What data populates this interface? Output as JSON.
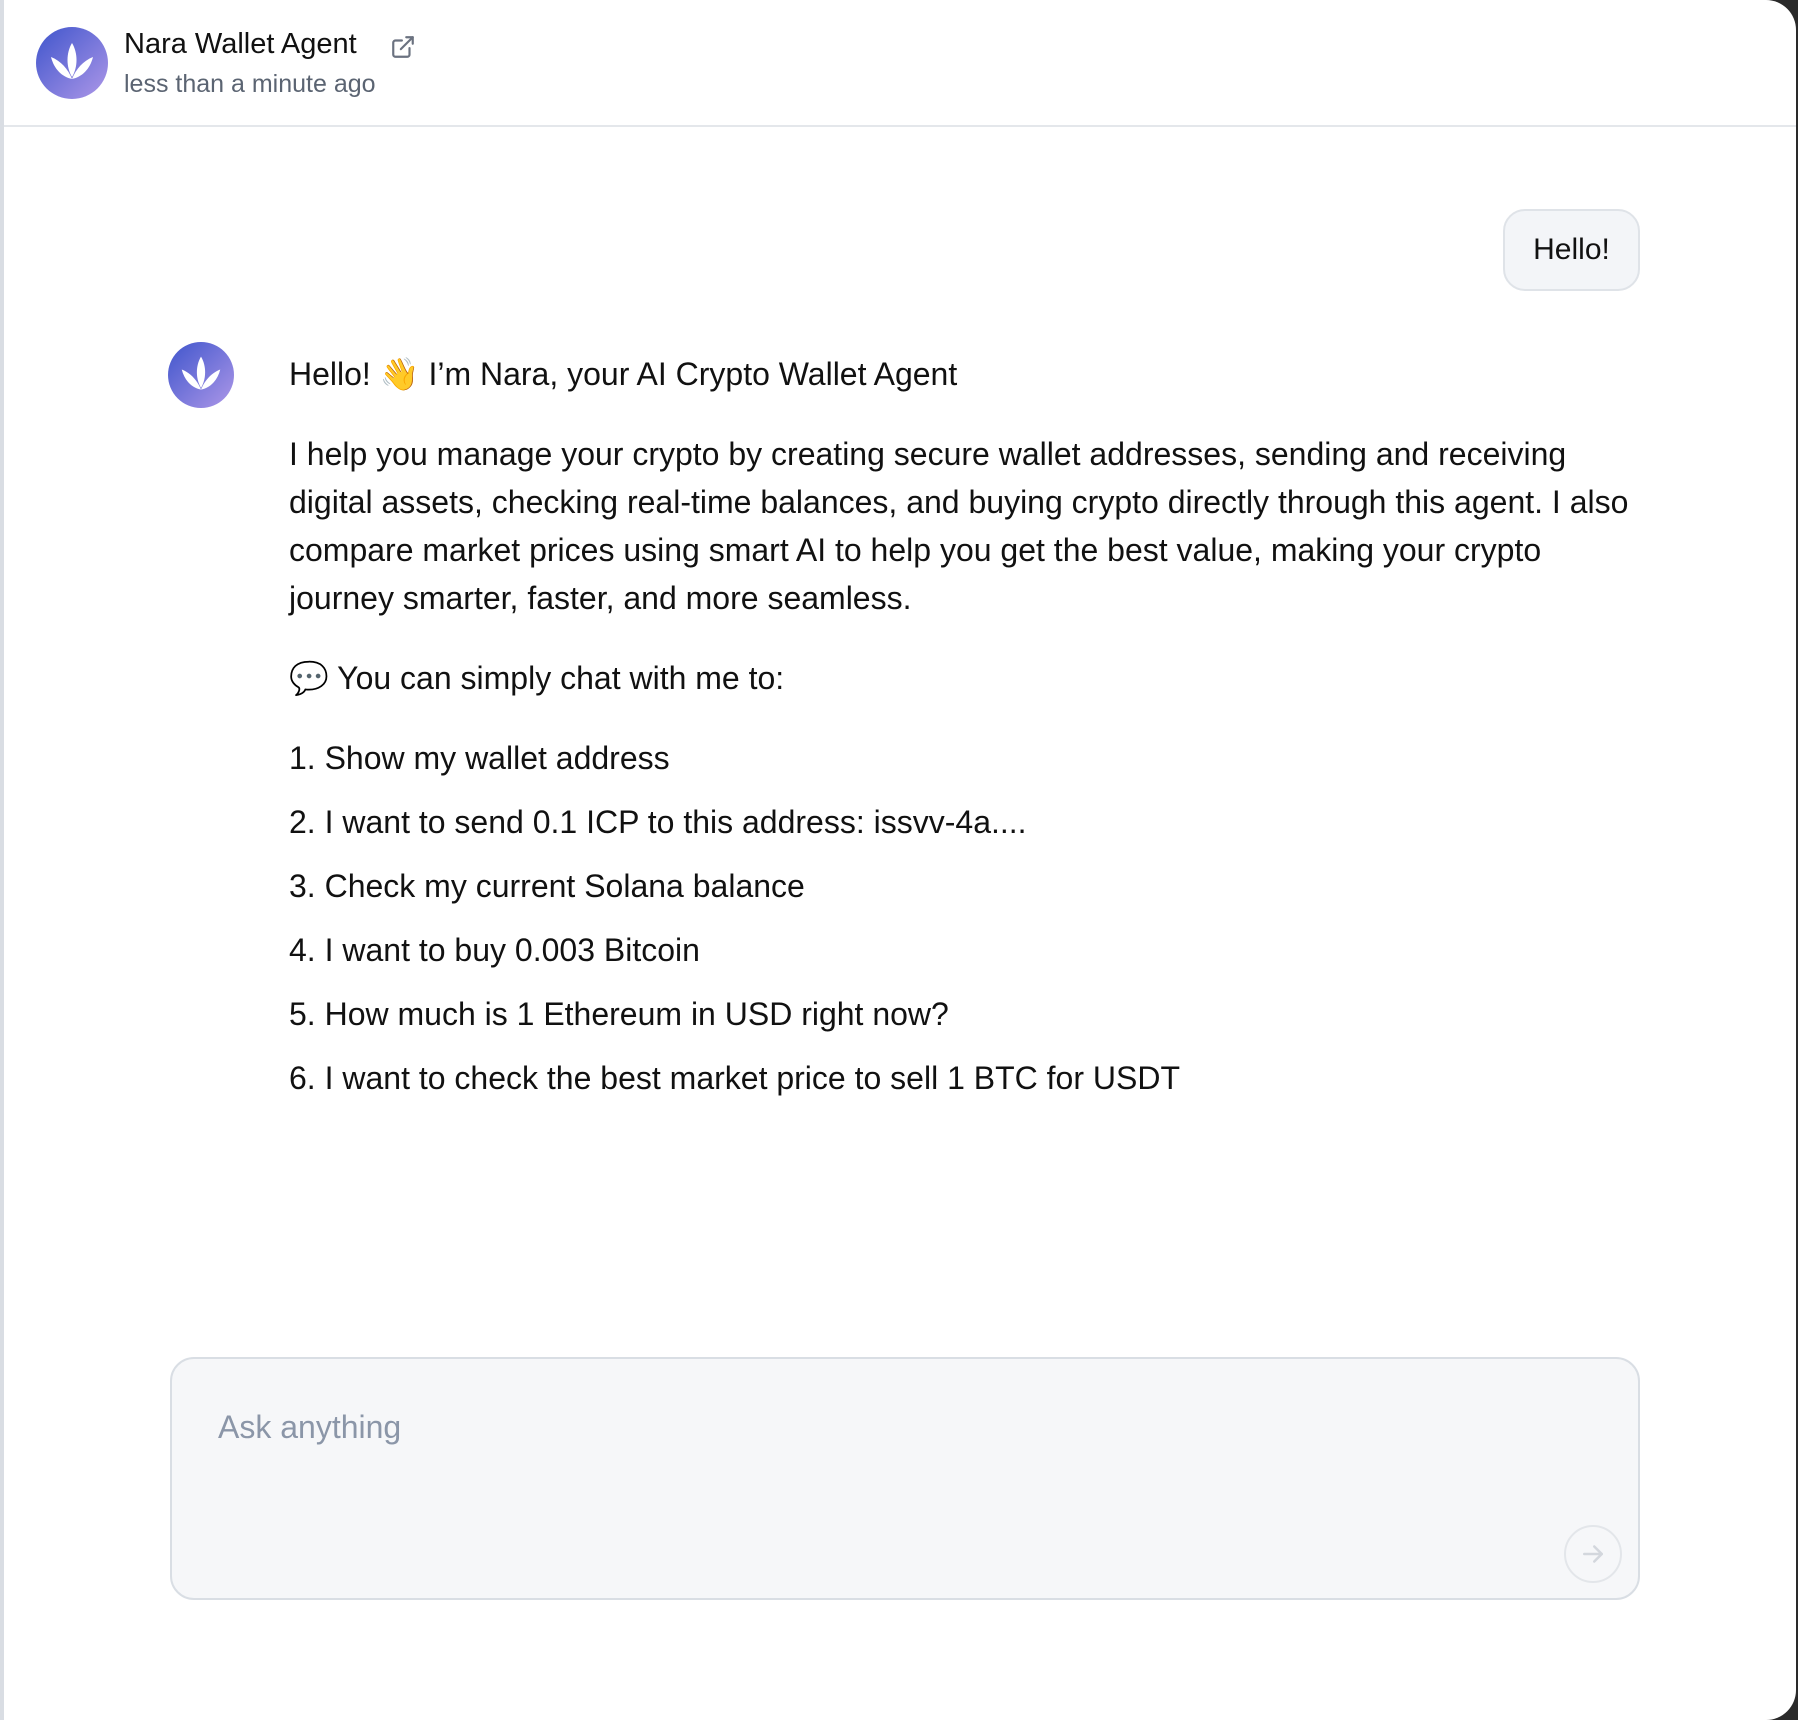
{
  "header": {
    "agent_name": "Nara Wallet Agent",
    "timestamp": "less than a minute ago",
    "avatar_icon": "lotus-logo-icon",
    "external_link_icon": "external-link-icon"
  },
  "conversation": {
    "user_message": "Hello!",
    "agent_reply": {
      "greeting_prefix": "Hello!",
      "greeting_emoji": "👋",
      "greeting_text": "I’m Nara, your AI Crypto Wallet Agent",
      "intro": "I help you manage your crypto by creating secure wallet addresses, sending and receiving digital assets, checking real-time balances, and buying crypto directly through this agent. I also compare market prices using smart AI to help you get the best value, making your crypto journey smarter, faster, and more seamless.",
      "prompt_emoji": "💬",
      "prompt_text": "You can simply chat with me to:",
      "suggestions": [
        "1. Show my wallet address",
        "2. I want to send 0.1 ICP to this address: issvv-4a....",
        "3. Check my current Solana balance",
        "4. I want to buy 0.003 Bitcoin",
        "5. How much is 1 Ethereum in USD right now?",
        "6. I want to check the best market price to sell 1 BTC for USDT"
      ]
    }
  },
  "composer": {
    "placeholder": "Ask anything",
    "value": "",
    "send_icon": "arrow-right-icon"
  },
  "colors": {
    "avatar_gradient_start": "#4a5fd0",
    "avatar_gradient_end": "#a792e6",
    "muted_text": "#5b6472",
    "placeholder": "#8b96a8"
  }
}
